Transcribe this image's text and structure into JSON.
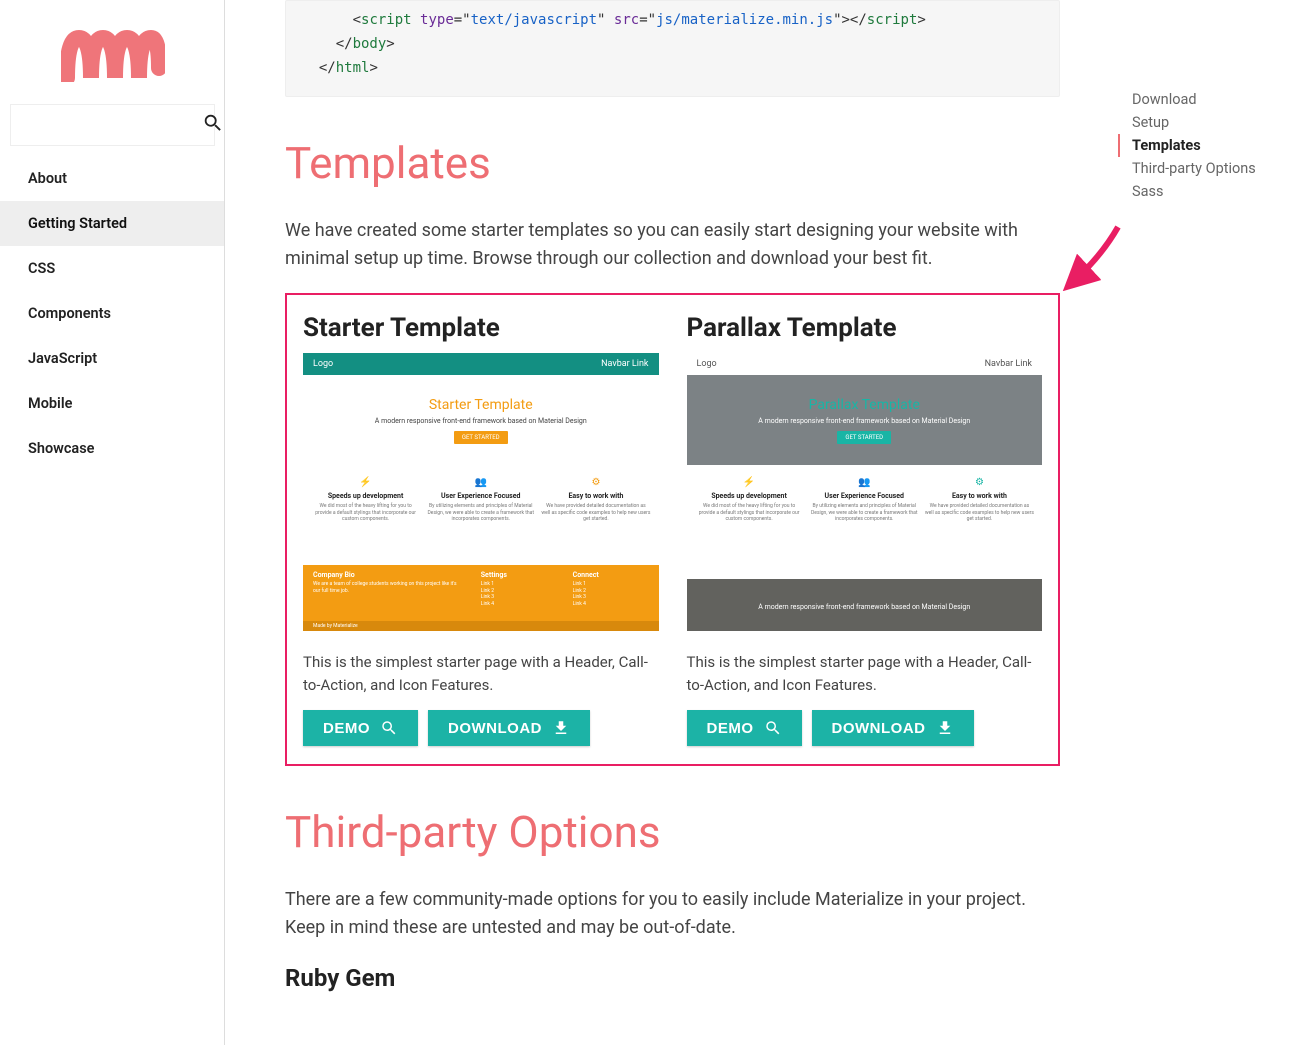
{
  "sidebar": {
    "search_placeholder": "",
    "items": [
      {
        "label": "About"
      },
      {
        "label": "Getting Started",
        "active": true
      },
      {
        "label": "CSS"
      },
      {
        "label": "Components"
      },
      {
        "label": "JavaScript"
      },
      {
        "label": "Mobile"
      },
      {
        "label": "Showcase"
      }
    ]
  },
  "code": {
    "line1_open": "script",
    "line1_attr1": "type",
    "line1_val1": "text/javascript",
    "line1_attr2": "src",
    "line1_val2": "js/materialize.min.js",
    "line1_close": "script",
    "line2": "body",
    "line3": "html"
  },
  "sections": {
    "templates": {
      "heading": "Templates",
      "desc": "We have created some starter templates so you can easily start designing your website with minimal setup up time. Browse through our collection and download your best fit."
    },
    "thirdparty": {
      "heading": "Third-party Options",
      "desc": "There are a few community-made options for you to easily include Materialize in your project. Keep in mind these are untested and may be out-of-date.",
      "sub1": "Ruby Gem"
    }
  },
  "templates": [
    {
      "title": "Starter Template",
      "desc": "This is the simplest starter page with a Header, Call-to-Action, and Icon Features.",
      "demo_label": "DEMO",
      "download_label": "DOWNLOAD",
      "thumb": {
        "nav_brand": "Logo",
        "nav_link": "Navbar Link",
        "hero_title": "Starter Template",
        "hero_sub": "A modern responsive front-end framework based on Material Design",
        "hero_btn": "GET STARTED",
        "features": [
          {
            "title": "Speeds up development"
          },
          {
            "title": "User Experience Focused"
          },
          {
            "title": "Easy to work with"
          }
        ],
        "footer_cols": [
          {
            "title": "Company Bio"
          },
          {
            "title": "Settings"
          },
          {
            "title": "Connect"
          }
        ],
        "made": "Made by Materialize"
      }
    },
    {
      "title": "Parallax Template",
      "desc": "This is the simplest starter page with a Header, Call-to-Action, and Icon Features.",
      "demo_label": "DEMO",
      "download_label": "DOWNLOAD",
      "thumb": {
        "nav_brand": "Logo",
        "nav_link": "Navbar Link",
        "hero_title": "Parallax Template",
        "hero_sub": "A modern responsive front-end framework based on Material Design",
        "hero_btn": "GET STARTED",
        "features": [
          {
            "title": "Speeds up development"
          },
          {
            "title": "User Experience Focused"
          },
          {
            "title": "Easy to work with"
          }
        ],
        "footer_text": "A modern responsive front-end framework based on Material Design"
      }
    }
  ],
  "toc": [
    {
      "label": "Download"
    },
    {
      "label": "Setup"
    },
    {
      "label": "Templates",
      "active": true
    },
    {
      "label": "Third-party Options"
    },
    {
      "label": "Sass"
    }
  ]
}
